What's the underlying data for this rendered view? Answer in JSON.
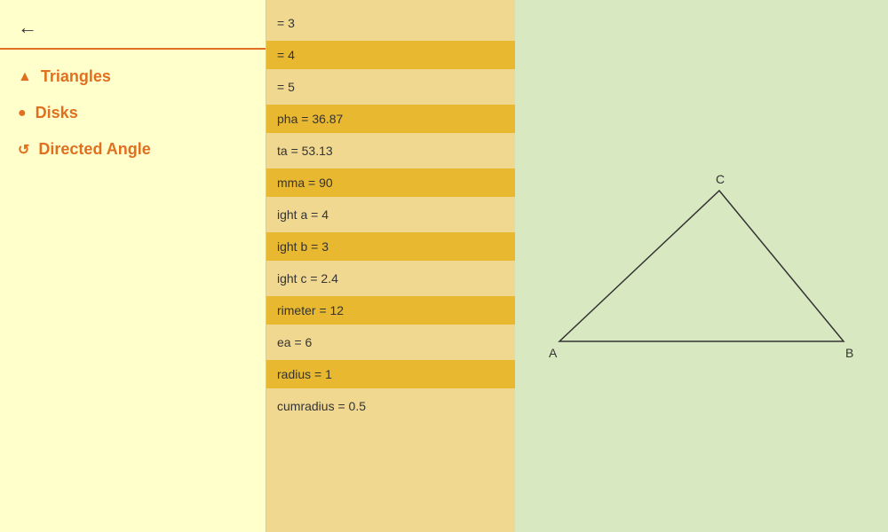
{
  "sidebar": {
    "back_arrow": "←",
    "nav_items": [
      {
        "id": "triangles",
        "icon": "▲",
        "label": "Triangles"
      },
      {
        "id": "disks",
        "icon": "●",
        "label": "Disks"
      },
      {
        "id": "directed-angle",
        "icon": "↺",
        "label": "Directed Angle"
      }
    ]
  },
  "data_panel": {
    "rows": [
      {
        "text": "= 3",
        "highlighted": false
      },
      {
        "text": "= 4",
        "highlighted": true
      },
      {
        "text": "= 5",
        "highlighted": false
      },
      {
        "text": "pha = 36.87",
        "highlighted": true
      },
      {
        "text": "ta = 53.13",
        "highlighted": false
      },
      {
        "text": "mma = 90",
        "highlighted": true
      },
      {
        "text": "ight a = 4",
        "highlighted": false
      },
      {
        "text": "ight b = 3",
        "highlighted": true
      },
      {
        "text": "ight c = 2.4",
        "highlighted": false
      },
      {
        "text": "rimeter = 12",
        "highlighted": true
      },
      {
        "text": "ea = 6",
        "highlighted": false
      },
      {
        "text": "radius = 1",
        "highlighted": true
      },
      {
        "text": "cumradius = 0.5",
        "highlighted": false
      }
    ]
  },
  "triangle": {
    "vertex_a_label": "A",
    "vertex_b_label": "B",
    "vertex_c_label": "C"
  }
}
